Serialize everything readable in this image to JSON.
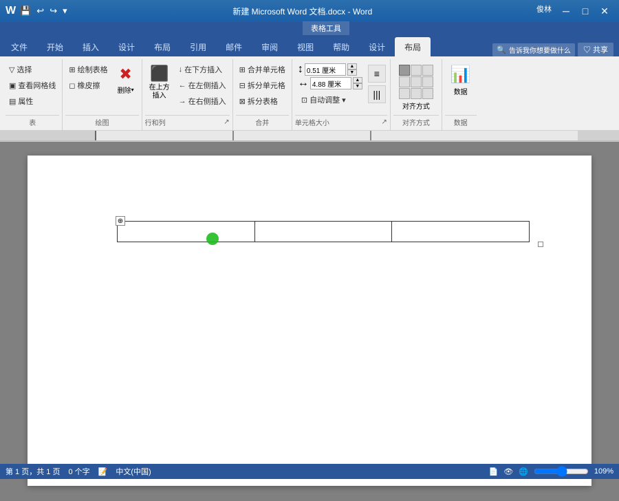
{
  "titleBar": {
    "title": "新建 Microsoft Word 文档.docx - Word",
    "appName": "Word",
    "userLabel": "俊林",
    "minBtn": "─",
    "maxBtn": "□",
    "closeBtn": "✕"
  },
  "quickAccess": {
    "save": "💾",
    "undo": "↩",
    "redo": "↪",
    "dropdown": "▾"
  },
  "tabs": [
    {
      "label": "文件",
      "active": false
    },
    {
      "label": "开始",
      "active": false
    },
    {
      "label": "插入",
      "active": false
    },
    {
      "label": "设计",
      "active": false
    },
    {
      "label": "布局",
      "active": false
    },
    {
      "label": "引用",
      "active": false
    },
    {
      "label": "邮件",
      "active": false
    },
    {
      "label": "审阅",
      "active": false
    },
    {
      "label": "视图",
      "active": false
    },
    {
      "label": "帮助",
      "active": false
    },
    {
      "label": "设计",
      "active": false
    },
    {
      "label": "布局",
      "active": true
    }
  ],
  "toolsLabel": "表格工具",
  "searchPlaceholder": "告诉我你想要做什么",
  "shareLabel": "♡ 共享",
  "ribbon": {
    "groups": [
      {
        "name": "table",
        "label": "表",
        "buttons": [
          {
            "id": "select",
            "label": "▽ 选择",
            "small": true
          },
          {
            "id": "view-grid",
            "label": "▣ 查看网格线",
            "small": true
          },
          {
            "id": "properties",
            "label": "▤ 属性",
            "small": true
          }
        ]
      },
      {
        "name": "draw",
        "label": "绘图",
        "buttons": [
          {
            "id": "draw-table",
            "label": "⊞ 绘制表格",
            "small": true
          },
          {
            "id": "eraser",
            "label": "✏ 橡皮擦",
            "small": true
          },
          {
            "id": "delete",
            "label": "删除",
            "icon": "✖",
            "large": true,
            "dropdown": true
          }
        ]
      },
      {
        "name": "rows-cols",
        "label": "行和列",
        "expander": true,
        "buttons": [
          {
            "id": "insert-below",
            "label": "在下方插入",
            "small": true
          },
          {
            "id": "insert-left",
            "label": "在左侧插入",
            "small": true
          },
          {
            "id": "insert-right",
            "label": "在右侧插入",
            "small": true
          },
          {
            "id": "insert-above",
            "label": "在上方插入",
            "large": true,
            "icon": "⬆",
            "iconLabel": "在上方插入"
          }
        ]
      },
      {
        "name": "merge",
        "label": "合并",
        "buttons": [
          {
            "id": "merge-cells",
            "label": "合并单元格",
            "small": true
          },
          {
            "id": "split-cells",
            "label": "拆分单元格",
            "small": true
          },
          {
            "id": "split-table",
            "label": "拆分表格",
            "small": true
          }
        ]
      },
      {
        "name": "cell-size",
        "label": "单元格大小",
        "expander": true,
        "height": {
          "value": "0.51",
          "unit": "厘米"
        },
        "width": {
          "value": "4.88",
          "unit": "厘米"
        },
        "autofit": "自动调整"
      },
      {
        "name": "align",
        "label": "对齐方式",
        "buttons": [
          {
            "id": "align-btn",
            "label": "对齐方式",
            "large": true,
            "icon": "▦"
          }
        ]
      },
      {
        "name": "data",
        "label": "数据",
        "buttons": [
          {
            "id": "data-btn",
            "label": "数据",
            "large": true,
            "icon": "📊"
          }
        ]
      }
    ]
  },
  "statusBar": {
    "pages": "第 1 页，共 1 页",
    "words": "0 个字",
    "lang": "中文(中国)",
    "zoom": "109%"
  },
  "document": {
    "table": {
      "rows": 1,
      "cols": 3
    }
  }
}
